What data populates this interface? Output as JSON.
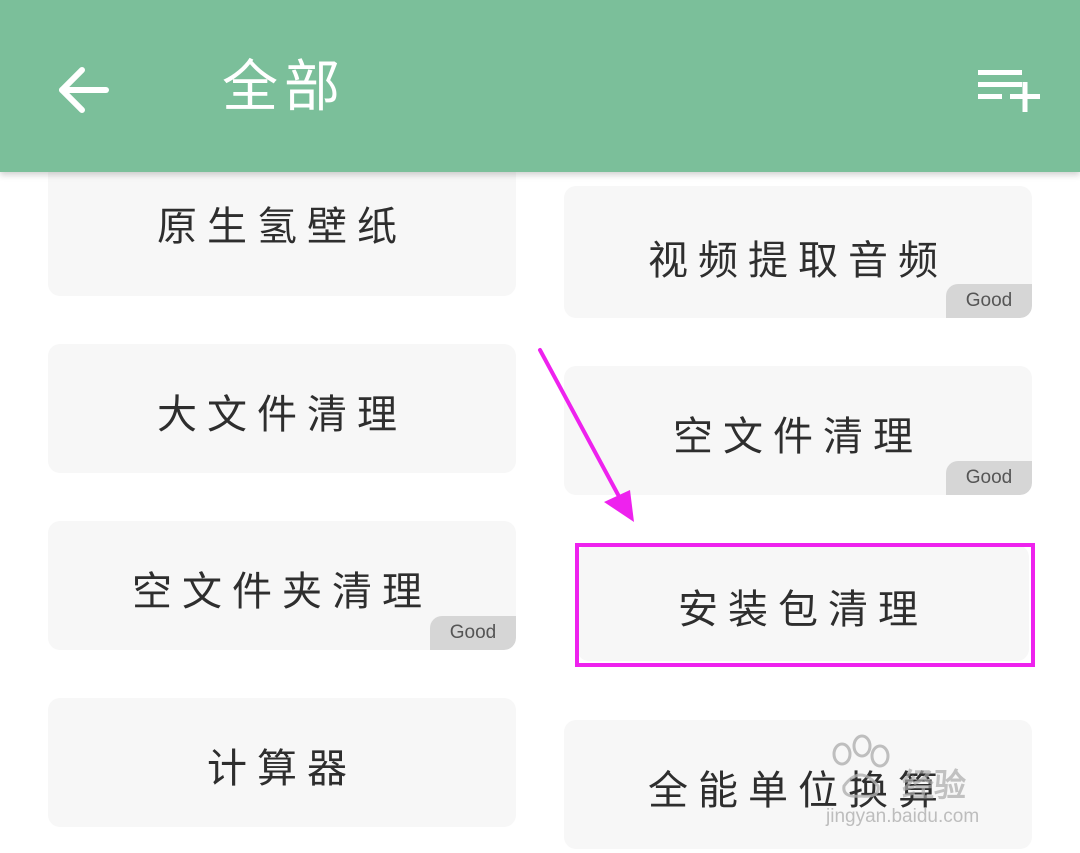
{
  "header": {
    "title": "全部",
    "back_icon": "arrow-left-icon",
    "action_icon": "playlist-add-icon",
    "background_color": "#7bbf9a"
  },
  "tools": [
    {
      "label": "原生氢壁纸",
      "badge": ""
    },
    {
      "label": "视频提取音频",
      "badge": "Good"
    },
    {
      "label": "大文件清理",
      "badge": ""
    },
    {
      "label": "空文件清理",
      "badge": "Good"
    },
    {
      "label": "空文件夹清理",
      "badge": "Good"
    },
    {
      "label": "安装包清理",
      "badge": ""
    },
    {
      "label": "计算器",
      "badge": ""
    },
    {
      "label": "全能单位换算",
      "badge": ""
    }
  ],
  "annotation": {
    "highlight_color": "#ee22ee"
  },
  "watermark": {
    "main": "经验",
    "sub": "jingyan.baidu.com"
  }
}
